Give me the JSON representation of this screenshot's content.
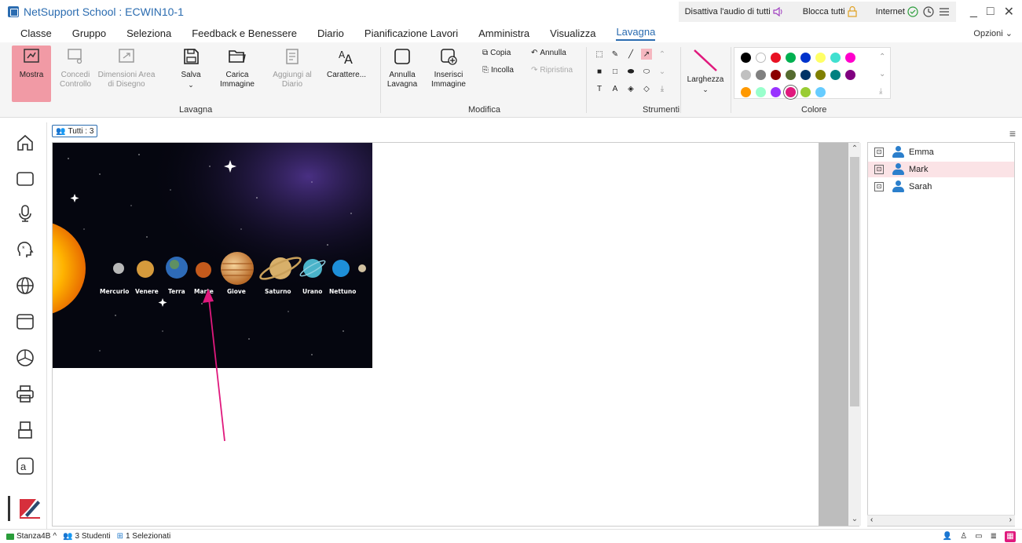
{
  "window": {
    "title": "NetSupport School : ECWIN10-1",
    "quick": {
      "mute_all": "Disattiva l'audio di tutti",
      "lock_all": "Blocca tutti",
      "internet": "Internet"
    }
  },
  "menu": {
    "tabs": [
      "Classe",
      "Gruppo",
      "Seleziona",
      "Feedback e Benessere",
      "Diario",
      "Pianificazione Lavori",
      "Amministra",
      "Visualizza",
      "Lavagna"
    ],
    "active": "Lavagna",
    "options": "Opzioni"
  },
  "ribbon": {
    "lavagna": {
      "show": "Mostra",
      "give_control": "Concedi\nControllo",
      "draw_area": "Dimensioni Area\ndi Disegno",
      "save": "Salva",
      "load_image": "Carica\nImmagine",
      "add_to_journal": "Aggiungi al\nDiario",
      "fonts": "Carattere...",
      "label": "Lavagna"
    },
    "modifica": {
      "clear_board": "Annulla\nLavagna",
      "insert_image": "Inserisci\nImmagine",
      "copy": "Copia",
      "paste": "Incolla",
      "undo": "Annulla",
      "redo": "Ripristina",
      "label": "Modifica"
    },
    "strumenti": {
      "width": "Larghezza",
      "label": "Strumenti"
    },
    "colore": {
      "label": "Colore",
      "row1": [
        "#000000",
        "#ffffff",
        "#e81123",
        "#00b050",
        "#0033cc",
        "#ffff66",
        "#40e0d0",
        "#ff00cc"
      ],
      "row2": [
        "#c0c0c0",
        "#808080",
        "#8b0000",
        "#556b2f",
        "#003366",
        "#808000",
        "#008080",
        "#800080"
      ],
      "row3": [
        "#ff9900",
        "#99ffcc",
        "#9933ff",
        "#e0197d",
        "#99cc33",
        "#66ccff"
      ]
    }
  },
  "group": {
    "tutti": "Tutti : 3"
  },
  "planets": {
    "labels": [
      "Mercurio",
      "Venere",
      "Terra",
      "Marte",
      "Giove",
      "Saturno",
      "Urano",
      "Nettuno"
    ]
  },
  "students": [
    "Emma",
    "Mark",
    "Sarah"
  ],
  "status": {
    "room": "Stanza4B",
    "students": "3 Studenti",
    "selected": "1 Selezionati"
  }
}
